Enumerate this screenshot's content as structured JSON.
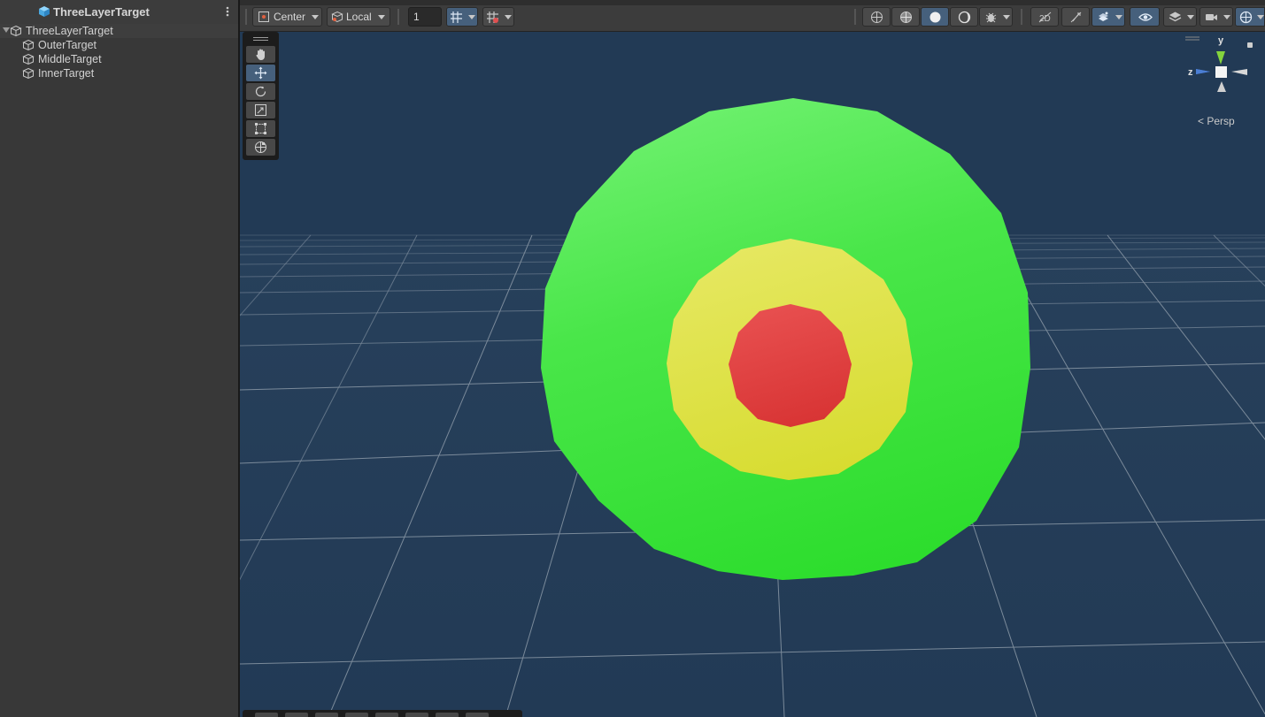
{
  "hierarchy": {
    "scene_title": "ThreeLayerTarget",
    "scene_icon": "unity-cube-icon",
    "menu_icon": "kebab-menu-icon",
    "root_object": "ThreeLayerTarget",
    "children": [
      "OuterTarget",
      "MiddleTarget",
      "InnerTarget"
    ]
  },
  "toolbar": {
    "pivot_mode": "Center",
    "pivot_rotation": "Local",
    "grid_size": "1",
    "icons": [
      "grid-snap-icon",
      "increment-snap-icon",
      "wireframe-shading-icon",
      "shaded-wireframe-icon",
      "shaded-icon",
      "unlit-shading-icon",
      "debug-draw-icon",
      "2d-toggle-icon",
      "lighting-toggle-icon",
      "effects-icon",
      "visibility-icon",
      "layers-icon",
      "camera-icon",
      "gizmos-icon"
    ]
  },
  "viewport": {
    "projection_label": "Persp",
    "axis_labels": {
      "y": "y",
      "z": "z"
    },
    "tools": [
      "hand-tool-icon",
      "move-tool-icon",
      "rotate-tool-icon",
      "scale-tool-icon",
      "rect-tool-icon",
      "transform-tool-icon"
    ],
    "active_tool": "move-tool-icon",
    "colors": {
      "background": "#223a55",
      "outer_target": "#3ddf3d",
      "middle_target": "#dde03e",
      "inner_target": "#df3f3f",
      "grid": "#8a98a6"
    }
  }
}
